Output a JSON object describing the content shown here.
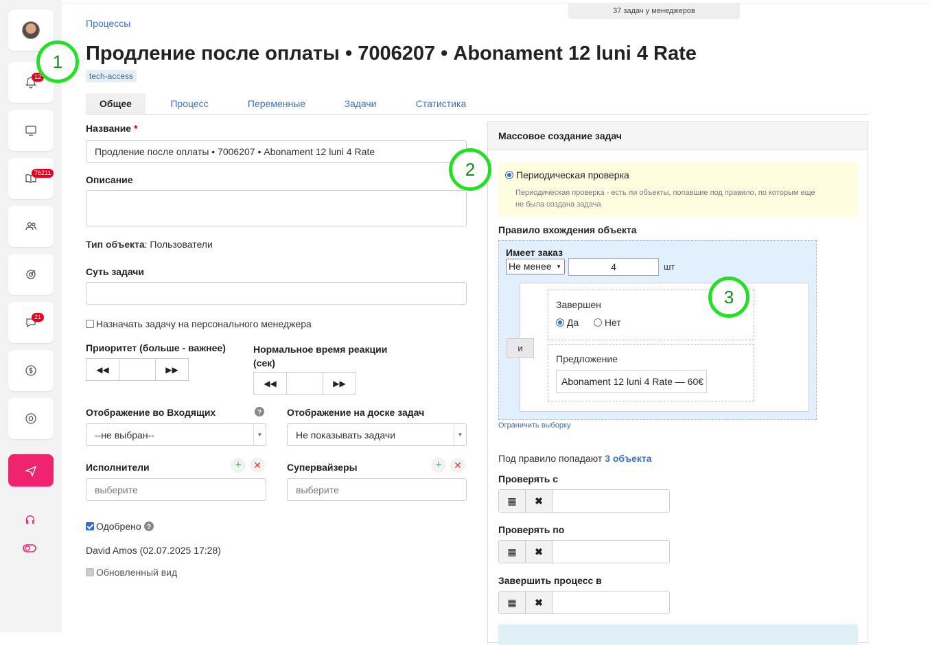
{
  "sidebar": {
    "badges": {
      "notifications": "12",
      "library": "76211",
      "chat": "21"
    }
  },
  "header": {
    "managers_badge": "37 задач у менеджеров",
    "breadcrumb": "Процессы",
    "title": "Продление после оплаты • 7006207 • Abonament 12 luni 4 Rate",
    "tag": "tech-access"
  },
  "tabs": [
    "Общее",
    "Процесс",
    "Переменные",
    "Задачи",
    "Статистика"
  ],
  "form": {
    "name_label": "Название",
    "name_required": "*",
    "name_value": "Продление после оплаты • 7006207 • Abonament 12 luni 4 Rate",
    "description_label": "Описание",
    "object_type_label": "Тип объекта",
    "object_type_value": ": Пользователи",
    "task_essence_label": "Суть задачи",
    "assign_personal_label": "Назначать задачу на персонального менеджера",
    "priority_label": "Приоритет (больше - важнее)",
    "reaction_label_1": "Нормальное время реакции",
    "reaction_label_2": "(сек)",
    "inbox_display_label": "Отображение во Входящих",
    "inbox_display_value": "--не выбран--",
    "board_display_label": "Отображение на доске задач",
    "board_display_value": "Не показывать задачи",
    "executors_label": "Исполнители",
    "executors_placeholder": "выберите",
    "supervisors_label": "Супервайзеры",
    "supervisors_placeholder": "выберите",
    "approved_label": "Одобрено",
    "approved_by": "David Amos (02.07.2025 17:28)",
    "updated_view_label": "Обновленный вид"
  },
  "panel": {
    "title": "Массовое создание задач",
    "periodic_label": "Периодическая проверка",
    "periodic_desc_1": "Периодическая проверка - есть ли объекты, попавшие под правило, по которым еще",
    "periodic_desc_2": "не была создана задача",
    "rule_label": "Правило вхождения объекта",
    "has_order_label": "Имеет заказ",
    "condition_value": "Не менее",
    "count_value": "4",
    "unit": "шт",
    "and_label": "и",
    "completed_label": "Завершен",
    "yes_label": "Да",
    "no_label": "Нет",
    "offer_label": "Предложение",
    "offer_value": "Abonament 12 luni 4 Rate — 60€",
    "limit_link": "Ограничить выборку",
    "matching_prefix": "Под правило попадают",
    "matching_link": "3 объекта",
    "check_from_label": "Проверять с",
    "check_to_label": "Проверять по",
    "finish_label": "Завершить процесс в"
  },
  "markers": [
    "1",
    "2",
    "3"
  ]
}
